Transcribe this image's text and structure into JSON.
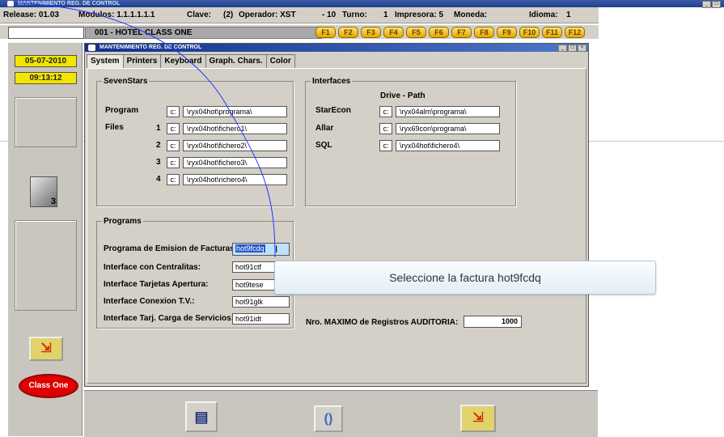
{
  "outer_window": {
    "title": "MANTENIMIENTO REG. DE CONTROL"
  },
  "info_bar": {
    "release": "Release: 01.03",
    "modulos": "Modulos: 1.1.1.1.1.1",
    "clave": "Clave:",
    "clave_val": "(2)",
    "operador": "Operador: XST",
    "turno_num": "- 10",
    "turno": "Turno:",
    "turno_val": "1",
    "impresora": "Impresora: 5",
    "moneda": "Moneda:",
    "idioma": "Idioma:",
    "idioma_val": "1"
  },
  "hotel_name": "001 - HOTEL CLASS ONE",
  "fkeys": [
    "F1",
    "F2",
    "F3",
    "F4",
    "F5",
    "F6",
    "F7",
    "F8",
    "F9",
    "F10",
    "F11",
    "F12"
  ],
  "left_panel": {
    "date": "05-07-2010",
    "time": "09:13:12",
    "avatar_badge": "3",
    "logo": "Class One"
  },
  "dialog": {
    "title": "MANTENIMIENTO REG. DE CONTROL",
    "tabs": [
      "System",
      "Printers",
      "Keyboard",
      "Graph. Chars.",
      "Color"
    ],
    "sevenstars": {
      "legend": "SevenStars",
      "program_label": "Program",
      "files_label": "Files",
      "rows": [
        {
          "num": "",
          "drive": "c:",
          "path": "\\ryx04hot\\programa\\"
        },
        {
          "num": "1",
          "drive": "c:",
          "path": "\\ryx04hot\\fichero1\\"
        },
        {
          "num": "2",
          "drive": "c:",
          "path": "\\ryx04hot\\fichero2\\"
        },
        {
          "num": "3",
          "drive": "c:",
          "path": "\\ryx04hot\\fichero3\\"
        },
        {
          "num": "4",
          "drive": "c:",
          "path": "\\ryx04hot\\richero4\\"
        }
      ]
    },
    "interfaces": {
      "legend": "Interfaces",
      "header": "Drive - Path",
      "rows": [
        {
          "label": "StarEcon",
          "drive": "c:",
          "path": "\\ryx04alm\\programa\\"
        },
        {
          "label": "Allar",
          "drive": "c:",
          "path": "\\ryx69con\\programa\\"
        },
        {
          "label": "SQL",
          "drive": "c:",
          "path": "\\ryx04hot\\fichero4\\"
        }
      ]
    },
    "programs": {
      "legend": "Programs",
      "rows": [
        {
          "label": "Programa de Emision de Facturas:",
          "value": "hot9fcdq"
        },
        {
          "label": "Interface con Centralitas:",
          "value": "hot91ctf"
        },
        {
          "label": "Interface Tarjetas Apertura:",
          "value": "hot9tese"
        },
        {
          "label": "Interface Conexion T.V.:",
          "value": "hot91glk"
        },
        {
          "label": "Interface Tarj. Carga de Servicios:",
          "value": "hot91idt"
        }
      ]
    },
    "auditoria": {
      "label": "Nro. MAXIMO de Registros AUDITORIA:",
      "value": "1000"
    }
  },
  "tooltip": "Seleccione la factura hot9fcdq",
  "colors": {
    "fkey_gold": "#e2a700",
    "date_yellow": "#f2e600",
    "title_blue": "#11318a",
    "selection_blue": "#2b58c6"
  },
  "icons": [
    "app-icon",
    "avatar-icon",
    "exit-icon",
    "save-icon",
    "refresh-icon",
    "cursor-icon"
  ]
}
